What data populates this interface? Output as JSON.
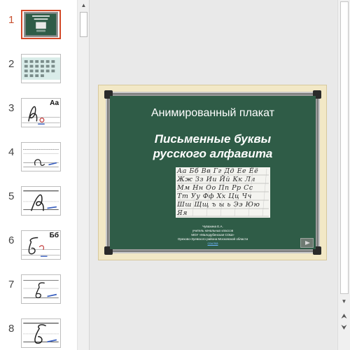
{
  "thumbnails": [
    {
      "number": "1",
      "style": "board",
      "letter": ""
    },
    {
      "number": "2",
      "style": "grid",
      "letter": ""
    },
    {
      "number": "3",
      "style": "letter-a",
      "letter": "Аа"
    },
    {
      "number": "4",
      "style": "lines-a",
      "letter": ""
    },
    {
      "number": "5",
      "style": "letter-big-a",
      "letter": ""
    },
    {
      "number": "6",
      "style": "letter-b",
      "letter": "Бб"
    },
    {
      "number": "7",
      "style": "lines-b",
      "letter": ""
    },
    {
      "number": "8",
      "style": "letter-big-b",
      "letter": ""
    }
  ],
  "slide": {
    "title": "Анимированный плакат",
    "subtitle_line1": "Письменные буквы",
    "subtitle_line2": "русского алфавита",
    "alphabet_rows": [
      "Аа Бб Вв Гг Дд Ее Ёё",
      "Жж Зз Ии Йй Кк Лл",
      "Мм Нн Оо Пп Рр Сс",
      "Тт Уу Фф Хх Цц Чч",
      "Шш Щщ ъ ы ь Ээ Юю",
      "Яя"
    ],
    "author_name": "Чувахина Е.А.",
    "author_line2": "учитель начальных классов",
    "author_line3": "МОУ «Малодубенская СОШ»",
    "author_line4": "Орехово-Зуевского района Московской области",
    "author_link": "ссылка"
  },
  "scrollbar": {
    "up_arrow": "▲",
    "down_arrow": "▼",
    "prev_slide": "⮝",
    "next_slide": "⮟"
  },
  "colors": {
    "board": "#2f5c47",
    "active_thumb": "#d24726",
    "slide_background": "#f2e8c6"
  }
}
